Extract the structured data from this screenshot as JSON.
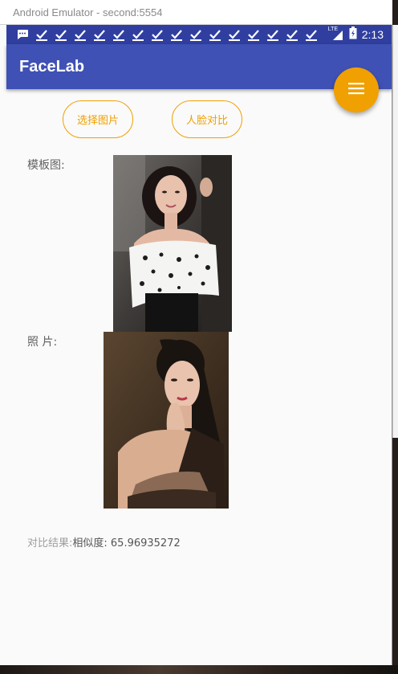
{
  "window": {
    "title": "Android Emulator - second:5554"
  },
  "status_bar": {
    "time": "2:13",
    "network": "LTE",
    "notification_icons": [
      "chat-icon",
      "check-icon",
      "check-icon",
      "check-icon",
      "check-icon",
      "check-icon",
      "check-icon",
      "check-icon",
      "check-icon",
      "check-icon",
      "check-icon",
      "check-icon",
      "check-icon",
      "check-icon",
      "check-icon",
      "check-icon"
    ]
  },
  "app_bar": {
    "title": "FaceLab"
  },
  "fab": {
    "icon": "menu-icon"
  },
  "actions": {
    "select_image": "选择图片",
    "face_compare": "人脸对比"
  },
  "template": {
    "label": "模板图:"
  },
  "photo": {
    "label": "照 片:"
  },
  "result": {
    "label": "对比结果:",
    "value": "相似度:  65.96935272"
  },
  "colors": {
    "primary": "#3f51b5",
    "primary_dark": "#303f9f",
    "accent": "#f0a000"
  }
}
